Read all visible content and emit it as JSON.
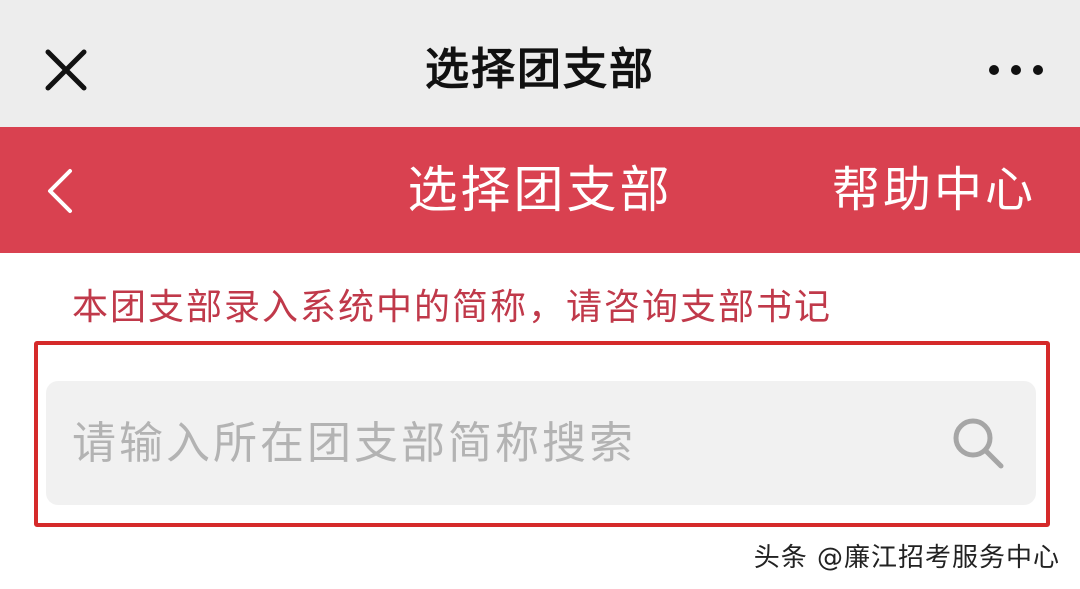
{
  "miniprogram_bar": {
    "title": "选择团支部",
    "close_icon": "close-icon",
    "more_icon": "more-dots-icon"
  },
  "header": {
    "title": "选择团支部",
    "back_icon": "chevron-left-icon",
    "help_label": "帮助中心",
    "background_color": "#d94150"
  },
  "hint": {
    "text": "本团支部录入系统中的简称，请咨询支部书记",
    "color": "#c0394a"
  },
  "search": {
    "placeholder": "请输入所在团支部简称搜索",
    "value": "",
    "icon": "search-icon",
    "highlight_color": "#d52a2a"
  },
  "watermark": {
    "text": "头条 @廉江招考服务中心"
  }
}
